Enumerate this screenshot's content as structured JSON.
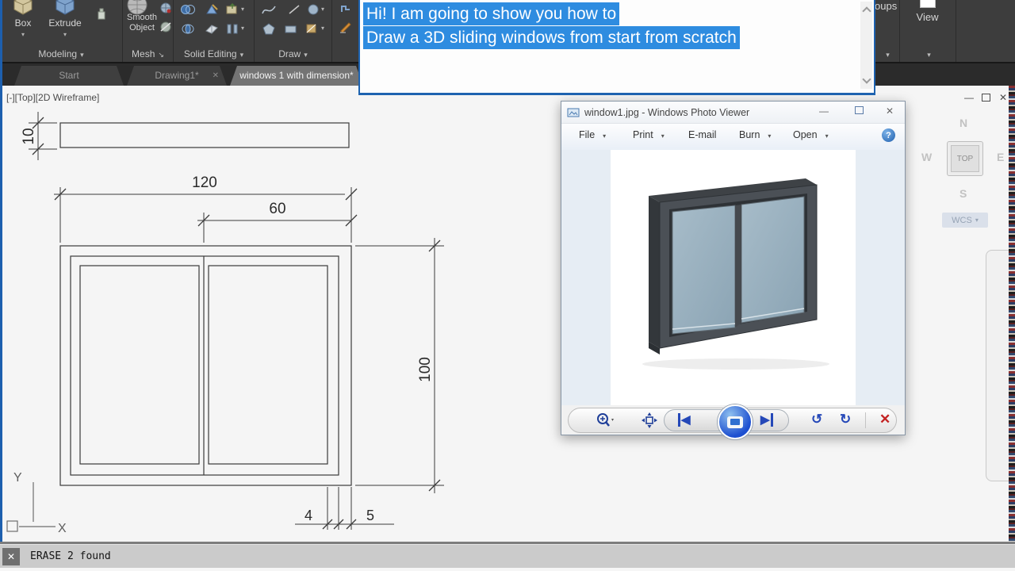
{
  "icons": {
    "caret_down": "▾",
    "launcher": "↘",
    "close": "✕",
    "minimize": "—",
    "help": "?",
    "prev": "◀",
    "next": "▶",
    "rotate_ccw": "↺",
    "rotate_cw": "↻",
    "delete": "✕"
  },
  "ribbon": {
    "modeling": {
      "panel_label": "Modeling",
      "box_label": "Box",
      "extrude_label": "Extrude"
    },
    "mesh": {
      "panel_label": "Mesh",
      "smooth_object_label": "Smooth Object"
    },
    "solid_editing": {
      "panel_label": "Solid Editing"
    },
    "draw": {
      "panel_label": "Draw"
    },
    "groups": {
      "panel_label_partial": "oups"
    },
    "view": {
      "panel_label": "View"
    }
  },
  "tabs": {
    "start": "Start",
    "drawing1": "Drawing1*",
    "active": "windows 1 with dimension*"
  },
  "caption_overlay": {
    "line1": "Hi! I am going to show you how to",
    "line2": "Draw a 3D sliding windows from start from scratch",
    "highlight_color": "#2e8ce0"
  },
  "viewport_label": "[-][Top][2D Wireframe]",
  "drawing": {
    "dim_frame_thickness": "10",
    "dim_total_width": "120",
    "dim_half_width": "60",
    "dim_height": "100",
    "dim_small_left": "4",
    "dim_small_right": "5",
    "axis_x": "X",
    "axis_y": "Y"
  },
  "viewcube": {
    "north": "N",
    "west": "W",
    "east": "E",
    "south": "S",
    "top": "TOP",
    "wcs": "WCS"
  },
  "photo_viewer": {
    "title": "window1.jpg - Windows Photo Viewer",
    "menu": [
      {
        "label": "File"
      },
      {
        "label": "Print"
      },
      {
        "label": "E-mail"
      },
      {
        "label": "Burn"
      },
      {
        "label": "Open"
      }
    ]
  },
  "command_bar": {
    "text": "ERASE 2 found"
  }
}
